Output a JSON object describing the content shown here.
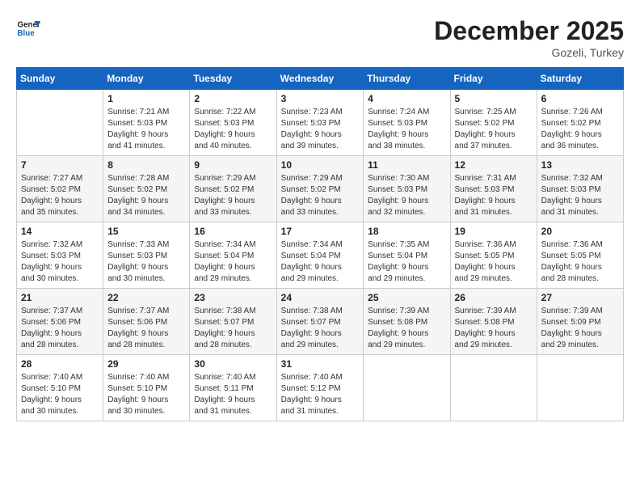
{
  "header": {
    "logo_line1": "General",
    "logo_line2": "Blue",
    "month": "December 2025",
    "location": "Gozeli, Turkey"
  },
  "days_of_week": [
    "Sunday",
    "Monday",
    "Tuesday",
    "Wednesday",
    "Thursday",
    "Friday",
    "Saturday"
  ],
  "weeks": [
    [
      {
        "day": "",
        "info": ""
      },
      {
        "day": "1",
        "info": "Sunrise: 7:21 AM\nSunset: 5:03 PM\nDaylight: 9 hours\nand 41 minutes."
      },
      {
        "day": "2",
        "info": "Sunrise: 7:22 AM\nSunset: 5:03 PM\nDaylight: 9 hours\nand 40 minutes."
      },
      {
        "day": "3",
        "info": "Sunrise: 7:23 AM\nSunset: 5:03 PM\nDaylight: 9 hours\nand 39 minutes."
      },
      {
        "day": "4",
        "info": "Sunrise: 7:24 AM\nSunset: 5:03 PM\nDaylight: 9 hours\nand 38 minutes."
      },
      {
        "day": "5",
        "info": "Sunrise: 7:25 AM\nSunset: 5:02 PM\nDaylight: 9 hours\nand 37 minutes."
      },
      {
        "day": "6",
        "info": "Sunrise: 7:26 AM\nSunset: 5:02 PM\nDaylight: 9 hours\nand 36 minutes."
      }
    ],
    [
      {
        "day": "7",
        "info": "Sunrise: 7:27 AM\nSunset: 5:02 PM\nDaylight: 9 hours\nand 35 minutes."
      },
      {
        "day": "8",
        "info": "Sunrise: 7:28 AM\nSunset: 5:02 PM\nDaylight: 9 hours\nand 34 minutes."
      },
      {
        "day": "9",
        "info": "Sunrise: 7:29 AM\nSunset: 5:02 PM\nDaylight: 9 hours\nand 33 minutes."
      },
      {
        "day": "10",
        "info": "Sunrise: 7:29 AM\nSunset: 5:02 PM\nDaylight: 9 hours\nand 33 minutes."
      },
      {
        "day": "11",
        "info": "Sunrise: 7:30 AM\nSunset: 5:03 PM\nDaylight: 9 hours\nand 32 minutes."
      },
      {
        "day": "12",
        "info": "Sunrise: 7:31 AM\nSunset: 5:03 PM\nDaylight: 9 hours\nand 31 minutes."
      },
      {
        "day": "13",
        "info": "Sunrise: 7:32 AM\nSunset: 5:03 PM\nDaylight: 9 hours\nand 31 minutes."
      }
    ],
    [
      {
        "day": "14",
        "info": "Sunrise: 7:32 AM\nSunset: 5:03 PM\nDaylight: 9 hours\nand 30 minutes."
      },
      {
        "day": "15",
        "info": "Sunrise: 7:33 AM\nSunset: 5:03 PM\nDaylight: 9 hours\nand 30 minutes."
      },
      {
        "day": "16",
        "info": "Sunrise: 7:34 AM\nSunset: 5:04 PM\nDaylight: 9 hours\nand 29 minutes."
      },
      {
        "day": "17",
        "info": "Sunrise: 7:34 AM\nSunset: 5:04 PM\nDaylight: 9 hours\nand 29 minutes."
      },
      {
        "day": "18",
        "info": "Sunrise: 7:35 AM\nSunset: 5:04 PM\nDaylight: 9 hours\nand 29 minutes."
      },
      {
        "day": "19",
        "info": "Sunrise: 7:36 AM\nSunset: 5:05 PM\nDaylight: 9 hours\nand 29 minutes."
      },
      {
        "day": "20",
        "info": "Sunrise: 7:36 AM\nSunset: 5:05 PM\nDaylight: 9 hours\nand 28 minutes."
      }
    ],
    [
      {
        "day": "21",
        "info": "Sunrise: 7:37 AM\nSunset: 5:06 PM\nDaylight: 9 hours\nand 28 minutes."
      },
      {
        "day": "22",
        "info": "Sunrise: 7:37 AM\nSunset: 5:06 PM\nDaylight: 9 hours\nand 28 minutes."
      },
      {
        "day": "23",
        "info": "Sunrise: 7:38 AM\nSunset: 5:07 PM\nDaylight: 9 hours\nand 28 minutes."
      },
      {
        "day": "24",
        "info": "Sunrise: 7:38 AM\nSunset: 5:07 PM\nDaylight: 9 hours\nand 29 minutes."
      },
      {
        "day": "25",
        "info": "Sunrise: 7:39 AM\nSunset: 5:08 PM\nDaylight: 9 hours\nand 29 minutes."
      },
      {
        "day": "26",
        "info": "Sunrise: 7:39 AM\nSunset: 5:08 PM\nDaylight: 9 hours\nand 29 minutes."
      },
      {
        "day": "27",
        "info": "Sunrise: 7:39 AM\nSunset: 5:09 PM\nDaylight: 9 hours\nand 29 minutes."
      }
    ],
    [
      {
        "day": "28",
        "info": "Sunrise: 7:40 AM\nSunset: 5:10 PM\nDaylight: 9 hours\nand 30 minutes."
      },
      {
        "day": "29",
        "info": "Sunrise: 7:40 AM\nSunset: 5:10 PM\nDaylight: 9 hours\nand 30 minutes."
      },
      {
        "day": "30",
        "info": "Sunrise: 7:40 AM\nSunset: 5:11 PM\nDaylight: 9 hours\nand 31 minutes."
      },
      {
        "day": "31",
        "info": "Sunrise: 7:40 AM\nSunset: 5:12 PM\nDaylight: 9 hours\nand 31 minutes."
      },
      {
        "day": "",
        "info": ""
      },
      {
        "day": "",
        "info": ""
      },
      {
        "day": "",
        "info": ""
      }
    ]
  ]
}
